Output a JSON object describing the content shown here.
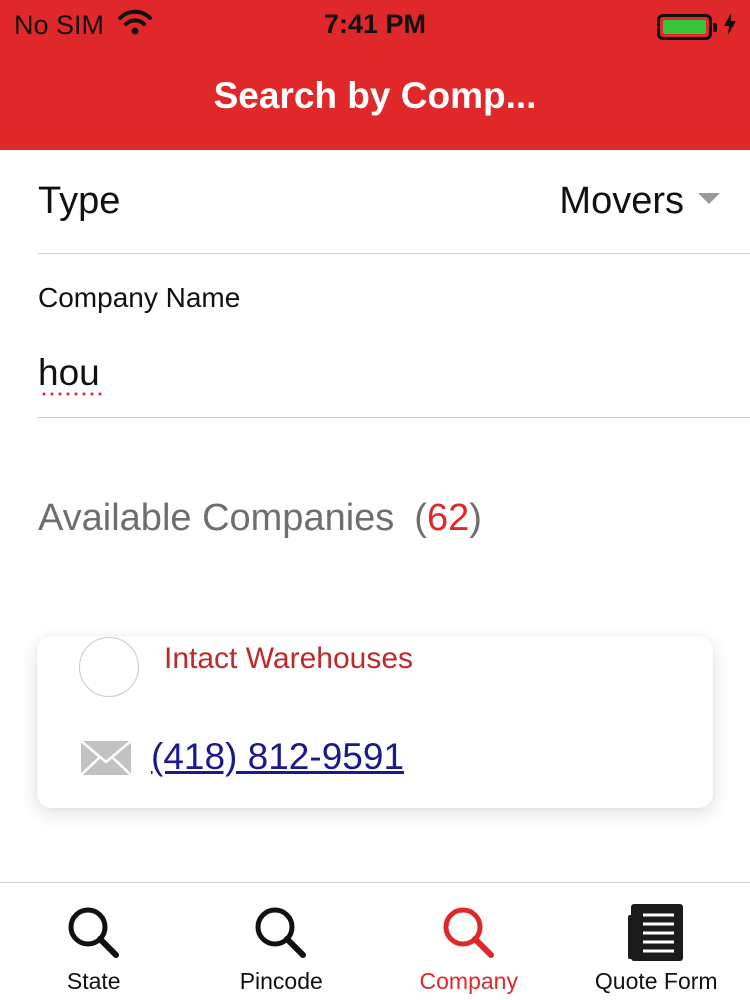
{
  "status_bar": {
    "carrier": "No SIM",
    "time": "7:41 PM"
  },
  "header": {
    "title": "Search by Comp..."
  },
  "form": {
    "type_label": "Type",
    "type_value": "Movers",
    "company_name_label": "Company Name",
    "company_name_value": "hou"
  },
  "results": {
    "heading": "Available Companies",
    "count_open": "(",
    "count": "62",
    "count_close": ")",
    "items": [
      {
        "name": "Intact Warehouses",
        "phone": "(418) 812-9591"
      }
    ]
  },
  "tab_bar": {
    "tabs": [
      {
        "label": "State",
        "icon": "search-icon",
        "active": false
      },
      {
        "label": "Pincode",
        "icon": "search-icon",
        "active": false
      },
      {
        "label": "Company",
        "icon": "search-icon",
        "active": true
      },
      {
        "label": "Quote Form",
        "icon": "document-icon",
        "active": false
      }
    ]
  },
  "colors": {
    "brand_red": "#e0282b",
    "link_blue": "#1a1a8e",
    "battery_green": "#3ac43a"
  }
}
